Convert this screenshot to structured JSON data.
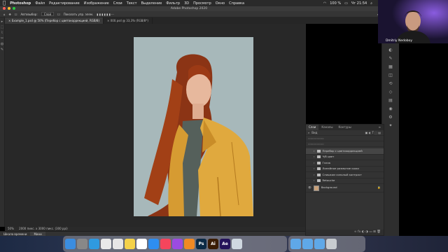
{
  "menubar": {
    "app": "Photoshop",
    "items": [
      "Файл",
      "Редактирование",
      "Изображение",
      "Слои",
      "Текст",
      "Выделение",
      "Фильтр",
      "3D",
      "Просмотр",
      "Окно",
      "Справка"
    ],
    "clock": "Чт 21:54",
    "battery": "100 %"
  },
  "window": {
    "title": "Adobe Photoshop 2020"
  },
  "options": {
    "label": "Автовыбор:",
    "select": "Слой",
    "checkbox": "Показать упр. элем."
  },
  "tabs": [
    {
      "label": "Example_1.psd @ 50% (Перебор с цветокоррекцией, RGB/8)"
    },
    {
      "label": "000.psd @ 33,3% (RGB/8*)"
    }
  ],
  "docstatus": {
    "zoom": "50%",
    "info": "2000 пикс. x 3000 пикс. (300 ppi)"
  },
  "timeline": {
    "tabs": [
      "Шкала времени",
      "Мини"
    ]
  },
  "webcam": {
    "name": "Dmitriy Nedoboy"
  },
  "layers_panel": {
    "tabs": [
      "Слои",
      "Каналы",
      "Контуры"
    ],
    "kind": "Вид",
    "layers": [
      {
        "name": "Перебор с цветокоррекцией",
        "type": "folder",
        "selected": true
      },
      {
        "name": "Ч/б цвет",
        "type": "folder"
      },
      {
        "name": "Глаза",
        "type": "folder"
      },
      {
        "name": "Линейное размытие кожи",
        "type": "folder"
      },
      {
        "name": "Слишком сильный контраст",
        "type": "folder"
      },
      {
        "name": "Retouche",
        "type": "folder"
      },
      {
        "name": "Background",
        "type": "image"
      }
    ]
  },
  "dock": {
    "apps": [
      {
        "icon": "finder-icon",
        "color": "#3b8de0"
      },
      {
        "icon": "launchpad-icon",
        "color": "#888888"
      },
      {
        "icon": "safari-icon",
        "color": "#2f9ae0"
      },
      {
        "icon": "photos-icon",
        "color": "#e9e9e9"
      },
      {
        "icon": "chrome-icon",
        "color": "#e6e6e6"
      },
      {
        "icon": "notes-icon",
        "color": "#f4d24a"
      },
      {
        "icon": "calendar-icon",
        "color": "#ffffff"
      },
      {
        "icon": "appstore-icon",
        "color": "#2e8ef0"
      },
      {
        "icon": "music-icon",
        "color": "#f5455c"
      },
      {
        "icon": "podcasts-icon",
        "color": "#9b4be0"
      },
      {
        "icon": "vlc-icon",
        "color": "#f08a24"
      },
      {
        "icon": "preview-icon",
        "color": "#cfd8e0"
      }
    ],
    "adobe": [
      {
        "label": "Ps",
        "color": "#0b2a45"
      },
      {
        "label": "Ai",
        "color": "#3a1d05"
      },
      {
        "label": "Ae",
        "color": "#25135a"
      }
    ]
  }
}
